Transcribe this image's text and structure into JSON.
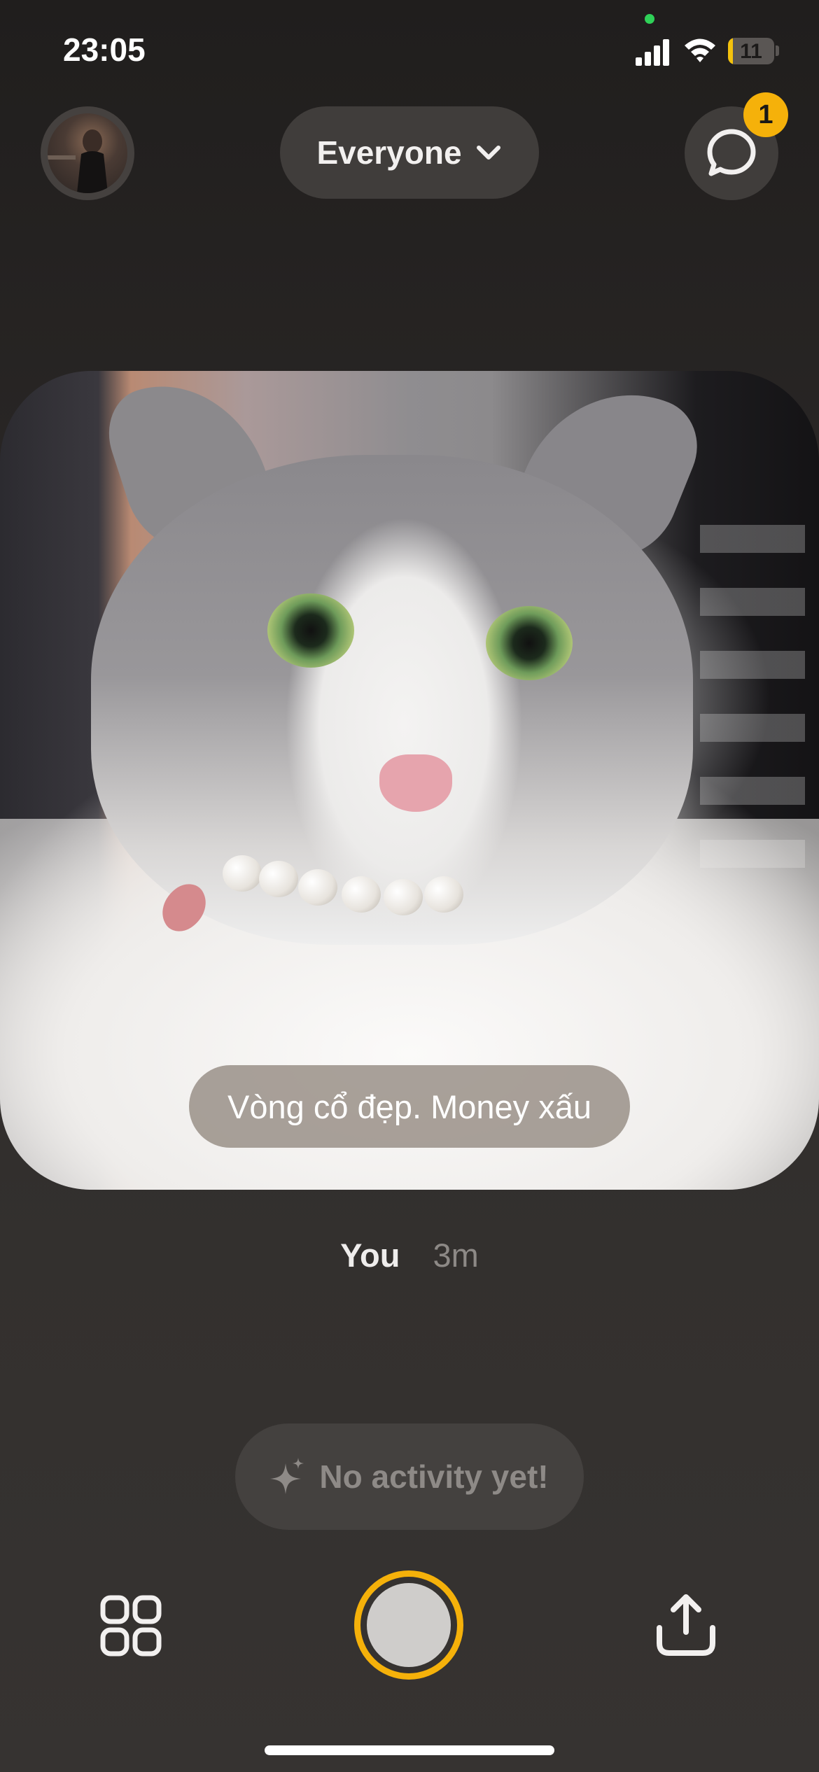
{
  "status_bar": {
    "time": "23:05",
    "battery_level": "11",
    "battery_fraction": 0.11,
    "signal_icon": "cellular-signal-icon",
    "wifi_icon": "wifi-icon",
    "privacy_dot_color": "#2fd158"
  },
  "header": {
    "audience_label": "Everyone",
    "audience_icon": "chevron-down-icon",
    "chat_icon": "chat-bubble-icon",
    "chat_badge_count": "1"
  },
  "post": {
    "caption": "Vòng cổ đẹp. Money xấu",
    "author": "You",
    "time_ago": "3m"
  },
  "activity": {
    "icon": "sparkle-icon",
    "label": "No activity yet!"
  },
  "bottom_bar": {
    "grid_icon": "grid-icon",
    "shutter_icon": "shutter-button",
    "share_icon": "share-icon"
  },
  "colors": {
    "accent": "#f5b10a",
    "background": "#2b2827",
    "pill": "#403d3b"
  }
}
